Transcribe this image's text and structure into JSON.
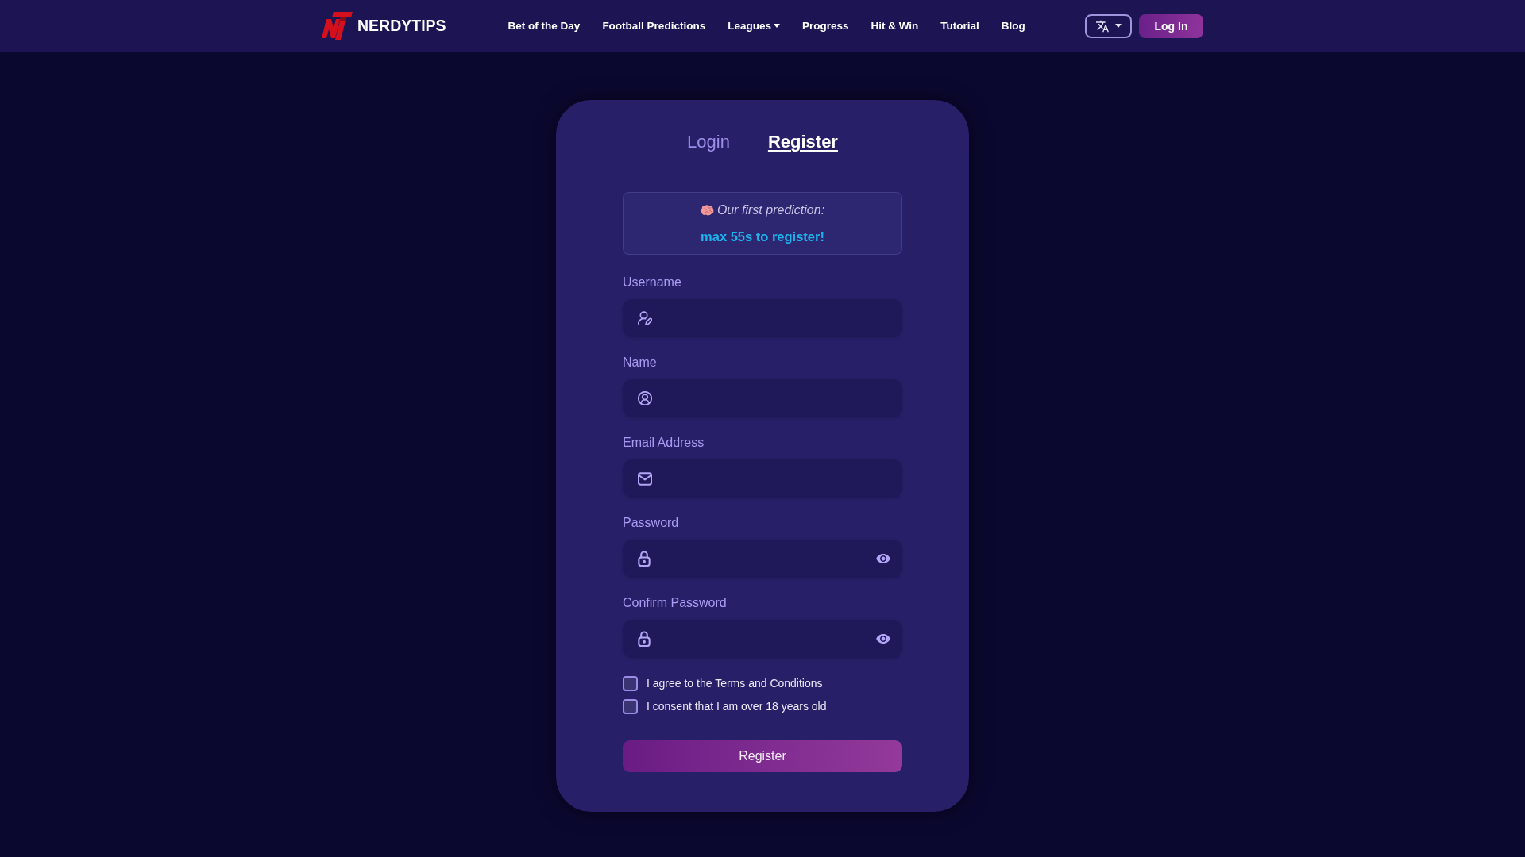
{
  "navbar": {
    "brand": "NERDYTIPS",
    "links": [
      {
        "label": "Bet of the Day",
        "kind": "link"
      },
      {
        "label": "Football Predictions",
        "kind": "link"
      },
      {
        "label": "Leagues",
        "kind": "dropdown"
      },
      {
        "label": "Progress",
        "kind": "link"
      },
      {
        "label": "Hit & Win",
        "kind": "link"
      },
      {
        "label": "Tutorial",
        "kind": "link"
      },
      {
        "label": "Blog",
        "kind": "link"
      }
    ],
    "login_button": "Log In"
  },
  "auth_card": {
    "tabs": [
      {
        "label": "Login",
        "selected": false
      },
      {
        "label": "Register",
        "selected": true
      }
    ],
    "notice": {
      "text": "Our first prediction:",
      "highlight": "max 55s to register!"
    },
    "fields": [
      {
        "label": "Username",
        "kind": "username"
      },
      {
        "label": "Name",
        "kind": "name"
      },
      {
        "label": "Email Address",
        "kind": "email"
      },
      {
        "label": "Password",
        "kind": "password"
      },
      {
        "label": "Confirm Password",
        "kind": "password"
      }
    ],
    "checkboxes": [
      {
        "label": "I agree to the Terms and Conditions",
        "checked": false
      },
      {
        "label": "I consent that I am over 18 years old",
        "checked": false
      }
    ],
    "submit_button": "Register"
  }
}
